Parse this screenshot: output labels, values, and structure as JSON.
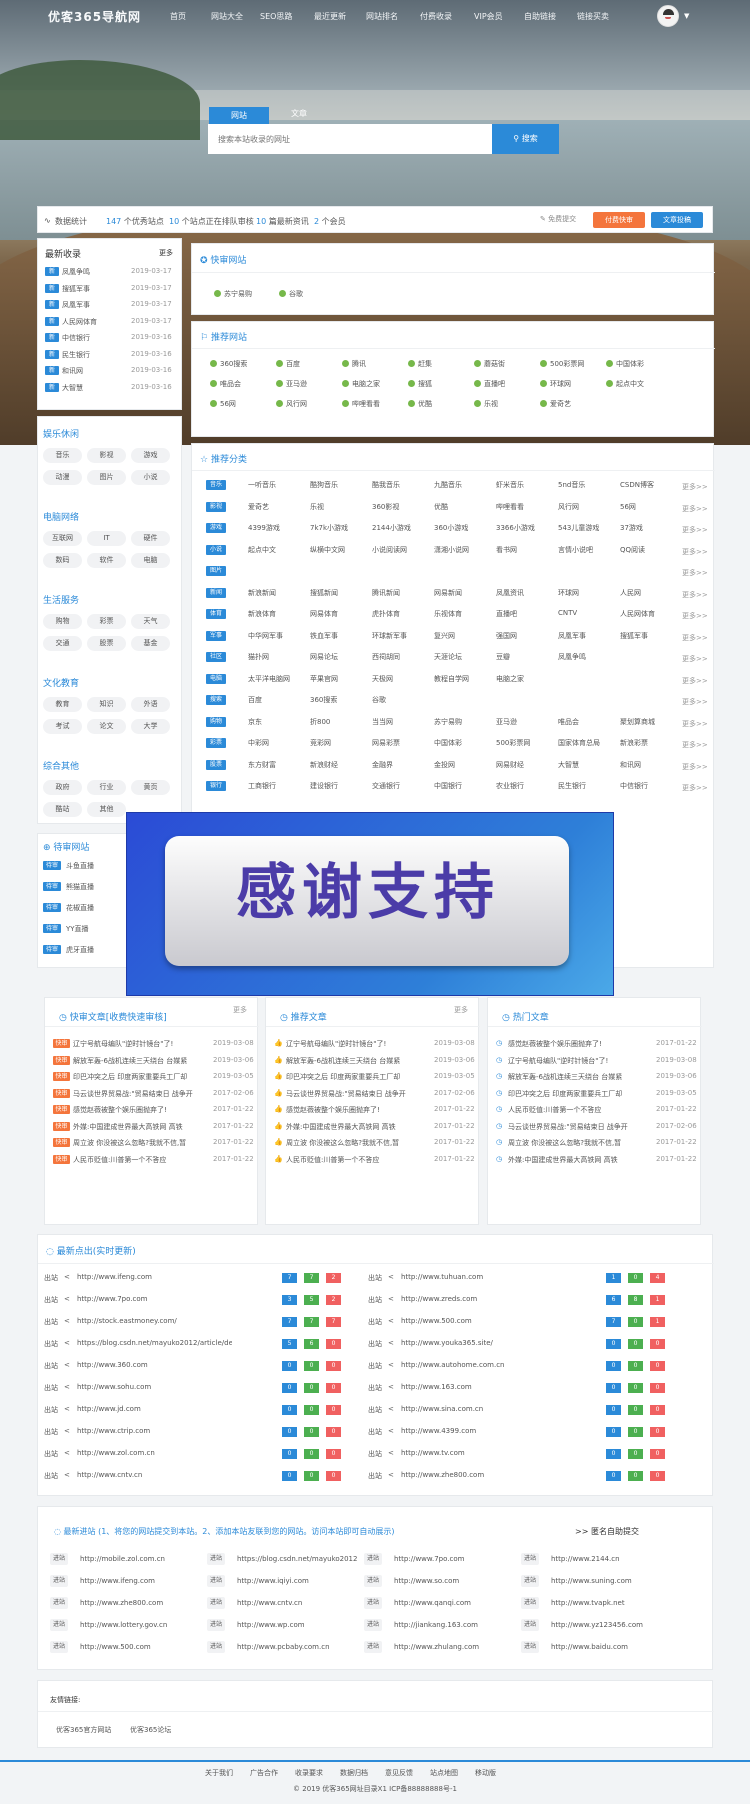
{
  "header": {
    "logo": "优客365导航网",
    "nav": [
      "首页",
      "网站大全",
      "SEO思路",
      "最近更新",
      "网站排名",
      "付费收录",
      "VIP会员",
      "自助链接",
      "链接买卖"
    ]
  },
  "search": {
    "tab_active": "网站",
    "tab_other": "文章",
    "placeholder": "搜索本站收录的网址",
    "button": "搜索"
  },
  "stats": {
    "label": "数据统计",
    "sites_num": "147",
    "sites_txt": "个优秀站点",
    "audit_num": "10",
    "audit_txt": "个站点正在排队审核",
    "news_num": "10",
    "news_txt": "篇最新资讯",
    "members_num": "2",
    "members_txt": "个会员",
    "free_submit": "免费提交",
    "paid": "付费快审",
    "article": "文章投稿"
  },
  "latest": {
    "title": "最新收录",
    "more": "更多",
    "items": [
      {
        "tag": "新",
        "name": "凤凰争鸣",
        "date": "2019-03-17"
      },
      {
        "tag": "新",
        "name": "搜狐军事",
        "date": "2019-03-17"
      },
      {
        "tag": "新",
        "name": "凤凰军事",
        "date": "2019-03-17"
      },
      {
        "tag": "新",
        "name": "人民网体育",
        "date": "2019-03-17"
      },
      {
        "tag": "新",
        "name": "中信银行",
        "date": "2019-03-16"
      },
      {
        "tag": "新",
        "name": "民生银行",
        "date": "2019-03-16"
      },
      {
        "tag": "新",
        "name": "和讯网",
        "date": "2019-03-16"
      },
      {
        "tag": "新",
        "name": "大智慧",
        "date": "2019-03-16"
      }
    ]
  },
  "fast": {
    "title": "快审网站",
    "items": [
      "苏宁易购",
      "谷歌"
    ]
  },
  "recommend": {
    "title": "推荐网站",
    "items": [
      "360搜索",
      "百度",
      "腾讯",
      "赶集",
      "蘑菇街",
      "500彩票网",
      "中国体彩",
      "唯品会",
      "亚马逊",
      "电脑之家",
      "搜狐",
      "直播吧",
      "环球网",
      "起点中文",
      "56网",
      "风行网",
      "哔哩看看",
      "优酷",
      "乐视",
      "爱奇艺"
    ]
  },
  "leftcats": [
    {
      "title": "娱乐休闲",
      "items": [
        "音乐",
        "影视",
        "游戏",
        "动漫",
        "图片",
        "小说"
      ]
    },
    {
      "title": "电脑网络",
      "items": [
        "互联网",
        "IT",
        "硬件",
        "数码",
        "软件",
        "电脑"
      ]
    },
    {
      "title": "生活服务",
      "items": [
        "购物",
        "彩票",
        "天气",
        "交通",
        "股票",
        "基金"
      ]
    },
    {
      "title": "文化教育",
      "items": [
        "教育",
        "知识",
        "外语",
        "考试",
        "论文",
        "大学"
      ]
    },
    {
      "title": "综合其他",
      "items": [
        "政府",
        "行业",
        "黄页",
        "酷站",
        "其他"
      ]
    }
  ],
  "pending": {
    "title": "待审网站",
    "tag": "待审",
    "items": [
      "斗鱼直播",
      "熊猫直播",
      "花椒直播",
      "YY直播",
      "虎牙直播"
    ]
  },
  "categories": {
    "title": "推荐分类",
    "more": "更多>>",
    "rows": [
      {
        "tag": "音乐",
        "items": [
          "一听音乐",
          "酷狗音乐",
          "酷我音乐",
          "九酷音乐",
          "虾米音乐",
          "5nd音乐",
          "CSDN博客"
        ]
      },
      {
        "tag": "影视",
        "items": [
          "爱奇艺",
          "乐视",
          "360影视",
          "优酷",
          "哔哩看看",
          "风行网",
          "56网"
        ]
      },
      {
        "tag": "游戏",
        "items": [
          "4399游戏",
          "7k7k小游戏",
          "2144小游戏",
          "360小游戏",
          "3366小游戏",
          "543儿童游戏",
          "37游戏"
        ]
      },
      {
        "tag": "小说",
        "items": [
          "起点中文",
          "纵横中文网",
          "小说阅读网",
          "潇湘小说网",
          "看书网",
          "言情小说吧",
          "QQ阅读"
        ]
      },
      {
        "tag": "图片",
        "items": []
      },
      {
        "tag": "新闻",
        "items": [
          "新浪新闻",
          "搜狐新闻",
          "腾讯新闻",
          "网易新闻",
          "凤凰资讯",
          "环球网",
          "人民网"
        ]
      },
      {
        "tag": "体育",
        "items": [
          "新浪体育",
          "网易体育",
          "虎扑体育",
          "乐视体育",
          "直播吧",
          "CNTV",
          "人民网体育"
        ]
      },
      {
        "tag": "军事",
        "items": [
          "中华网军事",
          "铁血军事",
          "环球新军事",
          "复兴网",
          "强国网",
          "凤凰军事",
          "搜狐军事"
        ]
      },
      {
        "tag": "社区",
        "items": [
          "猫扑网",
          "网易论坛",
          "西祠胡同",
          "天涯论坛",
          "豆瓣",
          "凤凰争鸣",
          ""
        ]
      },
      {
        "tag": "电脑",
        "items": [
          "太平洋电脑网",
          "苹果官网",
          "天极网",
          "教程自学网",
          "电脑之家",
          "",
          ""
        ]
      },
      {
        "tag": "搜索",
        "items": [
          "百度",
          "360搜索",
          "谷歌",
          "",
          "",
          "",
          ""
        ]
      },
      {
        "tag": "购物",
        "items": [
          "京东",
          "折800",
          "当当网",
          "苏宁易购",
          "亚马逊",
          "唯品会",
          "聚划算商城"
        ]
      },
      {
        "tag": "彩票",
        "items": [
          "中彩网",
          "竞彩网",
          "网易彩票",
          "中国体彩",
          "500彩票网",
          "国家体育总局",
          "新浪彩票"
        ]
      },
      {
        "tag": "股票",
        "items": [
          "东方财富",
          "新浪财经",
          "金融界",
          "金投网",
          "网易财经",
          "大智慧",
          "和讯网"
        ]
      },
      {
        "tag": "银行",
        "items": [
          "工商银行",
          "建设银行",
          "交通银行",
          "中国银行",
          "农业银行",
          "民生银行",
          "中信银行"
        ]
      }
    ]
  },
  "banner": {
    "text": "感谢支持"
  },
  "articles": [
    {
      "title": "快审文章[收费快速审核]",
      "more": "更多",
      "tag": "快审",
      "items": [
        {
          "t": "辽宁号航母编队\"逆时针镜台\"了!",
          "d": "2019-03-08"
        },
        {
          "t": "解放军轰-6战机连续三天绕台 台媒紧",
          "d": "2019-03-06"
        },
        {
          "t": "印巴冲突之后 印度两家重要兵工厂却",
          "d": "2019-03-05"
        },
        {
          "t": "马云谈世界贸易战:\"贸易结束日 战争开",
          "d": "2017-02-06"
        },
        {
          "t": "感觉赵薇被整个娱乐圈抛弃了!",
          "d": "2017-01-22"
        },
        {
          "t": "外媒:中国建成世界最大高铁网 高铁",
          "d": "2017-01-22"
        },
        {
          "t": "周立波 你没被这么忽略?我就不信,暂",
          "d": "2017-01-22"
        },
        {
          "t": "人民币贬值:川普第一个不答应",
          "d": "2017-01-22"
        }
      ]
    },
    {
      "title": "推荐文章",
      "more": "更多",
      "items": [
        {
          "t": "辽宁号航母编队\"逆时针镜台\"了!",
          "d": "2019-03-08"
        },
        {
          "t": "解放军轰-6战机连续三天绕台 台媒紧",
          "d": "2019-03-06"
        },
        {
          "t": "印巴冲突之后 印度两家重要兵工厂却",
          "d": "2019-03-05"
        },
        {
          "t": "马云谈世界贸易战:\"贸易结束日 战争开",
          "d": "2017-02-06"
        },
        {
          "t": "感觉赵薇被整个娱乐圈抛弃了!",
          "d": "2017-01-22"
        },
        {
          "t": "外媒:中国建成世界最大高铁网 高铁",
          "d": "2017-01-22"
        },
        {
          "t": "周立波 你没被这么忽略?我就不信,暂",
          "d": "2017-01-22"
        },
        {
          "t": "人民币贬值:川普第一个不答应",
          "d": "2017-01-22"
        }
      ]
    },
    {
      "title": "热门文章",
      "items": [
        {
          "t": "感觉赵薇被整个娱乐圈抛弃了!",
          "d": "2017-01-22"
        },
        {
          "t": "辽宁号航母编队\"逆时针镜台\"了!",
          "d": "2019-03-08"
        },
        {
          "t": "解放军轰-6战机连续三天绕台 台媒紧",
          "d": "2019-03-06"
        },
        {
          "t": "印巴冲突之后 印度两家重要兵工厂却",
          "d": "2019-03-05"
        },
        {
          "t": "人民币贬值:川普第一个不答应",
          "d": "2017-01-22"
        },
        {
          "t": "马云谈世界贸易战:\"贸易结束日 战争开",
          "d": "2017-02-06"
        },
        {
          "t": "周立波 你没被这么忽略?我就不信,暂",
          "d": "2017-01-22"
        },
        {
          "t": "外媒:中国建成世界最大高铁网 高铁",
          "d": "2017-01-22"
        }
      ]
    }
  ],
  "clicks": {
    "title": "最新点出(实时更新)",
    "label": "出站",
    "left": [
      {
        "u": "http://www.ifeng.com",
        "v": [
          "7",
          "7",
          "2"
        ]
      },
      {
        "u": "http://www.7po.com",
        "v": [
          "3",
          "5",
          "2"
        ]
      },
      {
        "u": "http://stock.eastmoney.com/",
        "v": [
          "7",
          "7",
          "7"
        ]
      },
      {
        "u": "https://blog.csdn.net/mayuko2012/article/details",
        "v": [
          "5",
          "6",
          "0"
        ]
      },
      {
        "u": "http://www.360.com",
        "v": [
          "0",
          "0",
          "0"
        ]
      },
      {
        "u": "http://www.sohu.com",
        "v": [
          "0",
          "0",
          "0"
        ]
      },
      {
        "u": "http://www.jd.com",
        "v": [
          "0",
          "0",
          "0"
        ]
      },
      {
        "u": "http://www.ctrip.com",
        "v": [
          "0",
          "0",
          "0"
        ]
      },
      {
        "u": "http://www.zol.com.cn",
        "v": [
          "0",
          "0",
          "0"
        ]
      },
      {
        "u": "http://www.cntv.cn",
        "v": [
          "0",
          "0",
          "0"
        ]
      }
    ],
    "right": [
      {
        "u": "http://www.tuhuan.com",
        "v": [
          "1",
          "0",
          "4"
        ]
      },
      {
        "u": "http://www.zreds.com",
        "v": [
          "6",
          "8",
          "1"
        ]
      },
      {
        "u": "http://www.500.com",
        "v": [
          "7",
          "0",
          "1"
        ]
      },
      {
        "u": "http://www.youka365.site/",
        "v": [
          "0",
          "0",
          "0"
        ]
      },
      {
        "u": "http://www.autohome.com.cn",
        "v": [
          "0",
          "0",
          "0"
        ]
      },
      {
        "u": "http://www.163.com",
        "v": [
          "0",
          "0",
          "0"
        ]
      },
      {
        "u": "http://www.sina.com.cn",
        "v": [
          "0",
          "0",
          "0"
        ]
      },
      {
        "u": "http://www.4399.com",
        "v": [
          "0",
          "0",
          "0"
        ]
      },
      {
        "u": "http://www.tv.com",
        "v": [
          "0",
          "0",
          "0"
        ]
      },
      {
        "u": "http://www.zhe800.com",
        "v": [
          "0",
          "0",
          "0"
        ]
      }
    ]
  },
  "visits": {
    "title": "最新进站 (1、将您的网站提交到本站。2、添加本站友联到您的网站。访问本站即可自动展示)",
    "anon": ">> 匿名自助提交",
    "label": "进站",
    "items": [
      "http://mobile.zol.com.cn",
      "https://blog.csdn.net/mayuko2012",
      "http://www.7po.com",
      "http://www.2144.cn",
      "http://www.ifeng.com",
      "http://www.iqiyi.com",
      "http://www.so.com",
      "http://www.suning.com",
      "http://www.zhe800.com",
      "http://www.cntv.cn",
      "http://www.qanqi.com",
      "http://www.tvapk.net",
      "http://www.lottery.gov.cn",
      "http://www.wp.com",
      "http://jiankang.163.com",
      "http://www.yz123456.com",
      "http://www.500.com",
      "http://www.pcbaby.com.cn",
      "http://www.zhulang.com",
      "http://www.baidu.com"
    ]
  },
  "friends": {
    "title": "友情链接:",
    "items": [
      "优客365官方网站",
      "优客365论坛"
    ]
  },
  "footer": {
    "links": [
      "关于我们",
      "广告合作",
      "收录要求",
      "数据归档",
      "意见反馈",
      "站点地图",
      "移动版"
    ],
    "copyright": "© 2019 优客365网址目录X1 ICP备88888888号-1"
  }
}
